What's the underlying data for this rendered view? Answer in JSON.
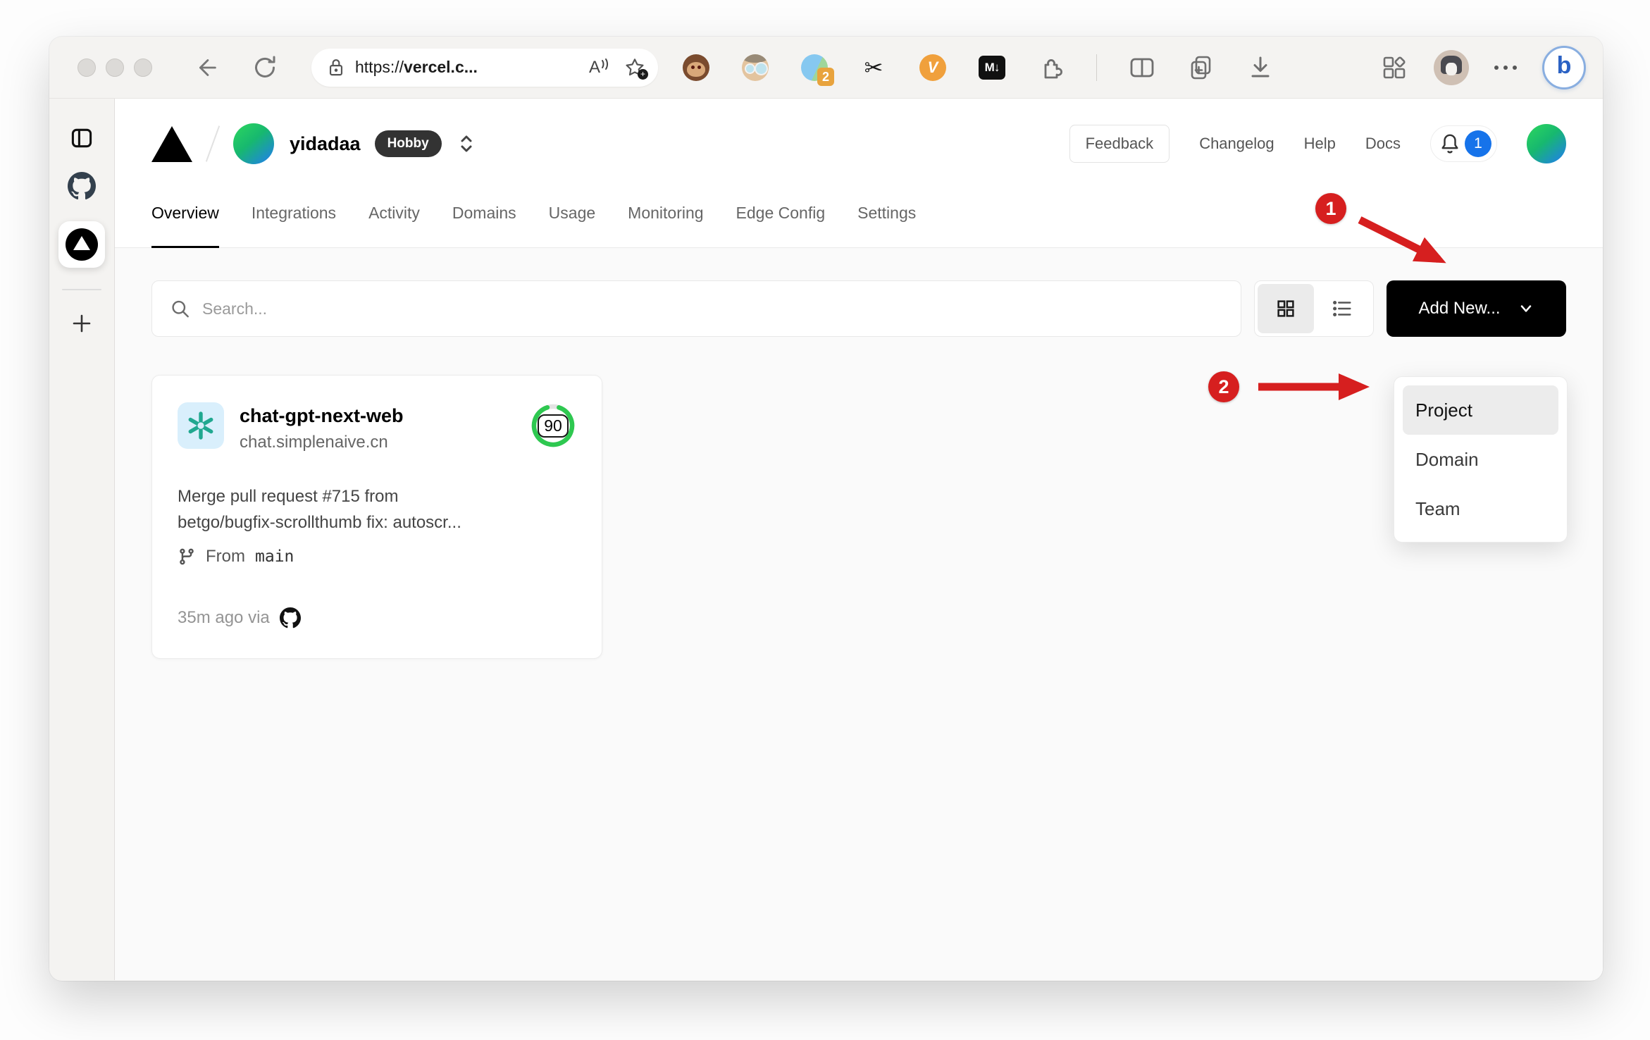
{
  "browser": {
    "url_scheme": "https://",
    "url_host": "vercel.c...",
    "read_aloud_label": "A",
    "extensions": {
      "badge_count": "2",
      "v_label": "V",
      "markdown_label": "M↓",
      "scissors_glyph": "✂",
      "bing_label": "b"
    }
  },
  "header": {
    "team_name": "yidadaa",
    "plan_badge": "Hobby",
    "feedback_label": "Feedback",
    "links": [
      "Changelog",
      "Help",
      "Docs"
    ],
    "notification_count": "1"
  },
  "nav": {
    "tabs": [
      "Overview",
      "Integrations",
      "Activity",
      "Domains",
      "Usage",
      "Monitoring",
      "Edge Config",
      "Settings"
    ],
    "active_tab": "Overview"
  },
  "toolbar": {
    "search_placeholder": "Search...",
    "add_new_label": "Add New..."
  },
  "dropdown": {
    "items": [
      "Project",
      "Domain",
      "Team"
    ],
    "highlighted": "Project"
  },
  "project_card": {
    "name": "chat-gpt-next-web",
    "domain": "chat.simplenaive.cn",
    "score": "90",
    "commit_line1": "Merge pull request #715 from",
    "commit_line2": "betgo/bugfix-scrollthumb fix: autoscr...",
    "branch_prefix": "From",
    "branch_name": "main",
    "deployed": "35m ago via"
  },
  "annotations": {
    "step1": "1",
    "step2": "2"
  },
  "colors": {
    "annotation_red": "#d61f1f",
    "score_green": "#2ec850",
    "notification_blue": "#1673ea",
    "add_button_bg": "#000000",
    "hobby_badge_bg": "#333333"
  }
}
